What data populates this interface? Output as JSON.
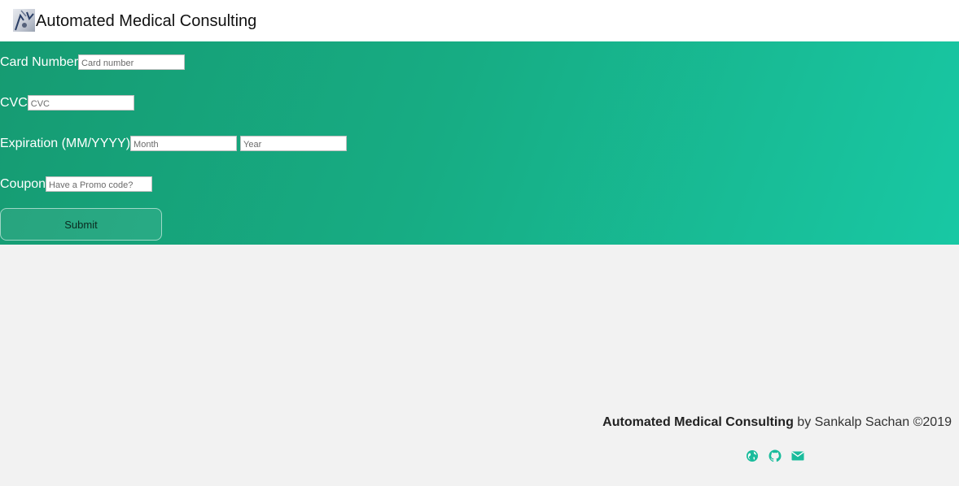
{
  "header": {
    "title": "Automated Medical Consulting",
    "logo_icon": "medical-logo-icon"
  },
  "form": {
    "card_number": {
      "label": "Card Number",
      "placeholder": "Card number",
      "value": ""
    },
    "cvc": {
      "label": "CVC",
      "placeholder": "CVC",
      "value": ""
    },
    "expiration": {
      "label": "Expiration (MM/YYYY)",
      "month_placeholder": "Month",
      "year_placeholder": "Year"
    },
    "coupon": {
      "label": "Coupon",
      "placeholder": "Have a Promo code?",
      "value": ""
    },
    "submit_label": "Submit"
  },
  "footer": {
    "brand": "Automated Medical Consulting",
    "credit": " by Sankalp Sachan ©2019",
    "icons": [
      "globe-icon",
      "github-icon",
      "envelope-icon"
    ]
  },
  "colors": {
    "accent": "#1abc9c",
    "form_gradient_start": "#169b72",
    "form_gradient_end": "#18c8a4",
    "page_background": "#f2f2f2"
  }
}
